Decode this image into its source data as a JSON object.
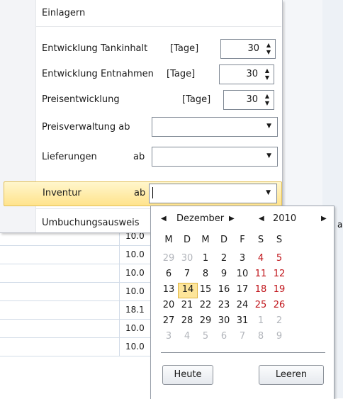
{
  "background": {
    "clipped_marker": "a",
    "rows": [
      "10.0",
      "10.0",
      "10.0",
      "10.0",
      "18.1",
      "10.0",
      "10.0"
    ]
  },
  "menu": {
    "items": [
      {
        "label": "Einlagern"
      },
      {
        "label": "Entwicklung Tankinhalt",
        "unit": "[Tage]",
        "value": "30"
      },
      {
        "label": "Entwicklung Entnahmen",
        "unit": "[Tage]",
        "value": "30"
      },
      {
        "label": "Preisentwicklung",
        "unit": "[Tage]",
        "value": "30"
      },
      {
        "label": "Preisverwaltung ab",
        "value": ""
      },
      {
        "label": "Lieferungen",
        "suffix": "ab",
        "value": ""
      },
      {
        "label": "Inventur",
        "suffix": "ab",
        "value": ""
      },
      {
        "label": "Umbuchungsausweis"
      }
    ]
  },
  "calendar": {
    "month": "Dezember",
    "year": "2010",
    "weekdays": [
      "M",
      "D",
      "M",
      "D",
      "F",
      "S",
      "S"
    ],
    "weeks": [
      [
        "29",
        "30",
        "1",
        "2",
        "3",
        "4",
        "5"
      ],
      [
        "6",
        "7",
        "8",
        "9",
        "10",
        "11",
        "12"
      ],
      [
        "13",
        "14",
        "15",
        "16",
        "17",
        "18",
        "19"
      ],
      [
        "20",
        "21",
        "22",
        "23",
        "24",
        "25",
        "26"
      ],
      [
        "27",
        "28",
        "29",
        "30",
        "31",
        "1",
        "2"
      ],
      [
        "3",
        "4",
        "5",
        "6",
        "7",
        "8",
        "9"
      ]
    ],
    "selected_day": "14",
    "today_button": "Heute",
    "clear_button": "Leeren",
    "colors": {
      "weekend": "#c0141a",
      "other_month": "#b2b5bb",
      "highlight": "#fde59a"
    }
  }
}
